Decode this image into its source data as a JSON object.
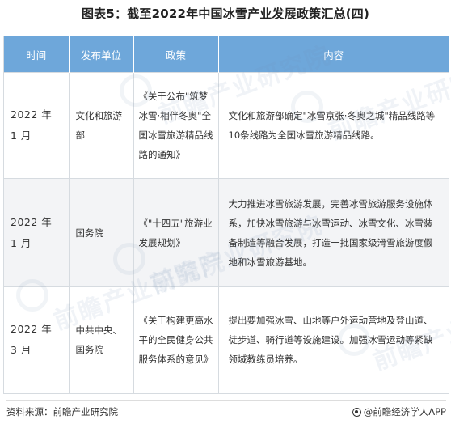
{
  "title": "图表5：截至2022年中国冰雪产业发展政策汇总(四)",
  "table": {
    "headers": [
      "时间",
      "发布单位",
      "政策",
      "内容"
    ],
    "rows": [
      {
        "time": "2022 年 1 月",
        "unit": "文化和旅游部",
        "policy": "《关于公布\"筑梦冰雪·相伴冬奥\"全国冰雪旅游精品线路的通知》",
        "content": "文化和旅游部确定\"冰雪京张·冬奥之城\"精品线路等10条线路为全国冰雪旅游精品线路。"
      },
      {
        "time": "2022 年 1 月",
        "unit": "国务院",
        "policy": "《\"十四五\"旅游业发展规划》",
        "content": "大力推进冰雪旅游发展，完善冰雪旅游服务设施体系，加快冰雪旅游与冰雪运动、冰雪文化、冰雪装备制造等融合发展，打造一批国家级滑雪旅游度假地和冰雪旅游基地。"
      },
      {
        "time": "2022 年 3 月",
        "unit": "中共中央、国务院",
        "policy": "《关于构建更高水平的全民健身公共服务体系的意见》",
        "content": "提出要加强冰雪、山地等户外运动营地及登山道、徒步道、骑行道等设施建设。加强冰雪运动等紧缺领域教练员培养。"
      }
    ]
  },
  "watermark_text": "前瞻产业研究院",
  "footer": {
    "source": "资料来源：前瞻产业研究院",
    "brand": "@前瞻经济学人APP"
  }
}
